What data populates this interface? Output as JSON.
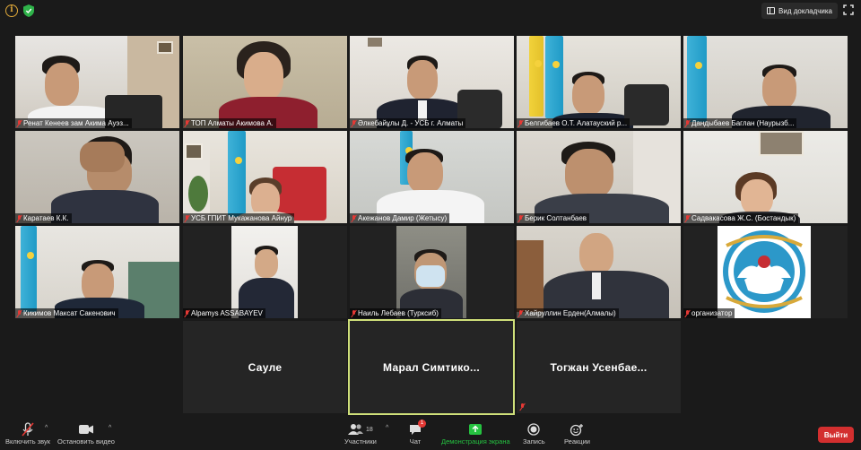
{
  "topbar": {
    "speaker_view_label": "Вид докладчика",
    "info_icon": "info-icon",
    "security_icon": "shield-icon",
    "fullscreen_icon": "fullscreen-icon"
  },
  "participants": [
    {
      "name": "Ренат Кенеев зам Акима Ауэз..."
    },
    {
      "name": "ТОП Алматы Акимова А."
    },
    {
      "name": "Әлкебайұлы Д. - УСБ г. Алматы"
    },
    {
      "name": "Белгибаев О.Т. Алатауский р..."
    },
    {
      "name": "Дандыбаев Баглан (Наурызб..."
    },
    {
      "name": "Каратаев К.К."
    },
    {
      "name": "УСБ ГПИТ Мукажанова Айнур"
    },
    {
      "name": "Акежанов Дамир (Жетысу)"
    },
    {
      "name": "Берик Солтанбаев"
    },
    {
      "name": "Садвакасова Ж.С. (Бостандык)"
    },
    {
      "name": "Кикимов Максат Сакенович"
    },
    {
      "name": "Alpamys ASSABAYEV"
    },
    {
      "name": "Наиль Лебаев (Турксиб)"
    },
    {
      "name": "Хайруллин Ерден(Алмалы)"
    },
    {
      "name": "организатор"
    }
  ],
  "name_only_tiles": [
    {
      "name": "Сауле"
    },
    {
      "name": "Марал  Симтико..."
    },
    {
      "name": "Тогжан  Усенбае..."
    }
  ],
  "toolbar": {
    "unmute_label": "Включить звук",
    "stop_video_label": "Остановить видео",
    "participants_label": "Участники",
    "participants_count": "18",
    "chat_label": "Чат",
    "chat_badge": "1",
    "share_label": "Демонстрация экрана",
    "record_label": "Запись",
    "reactions_label": "Реакции",
    "leave_label": "Выйти",
    "share_color": "#25c240",
    "leave_color": "#d32f2f"
  }
}
